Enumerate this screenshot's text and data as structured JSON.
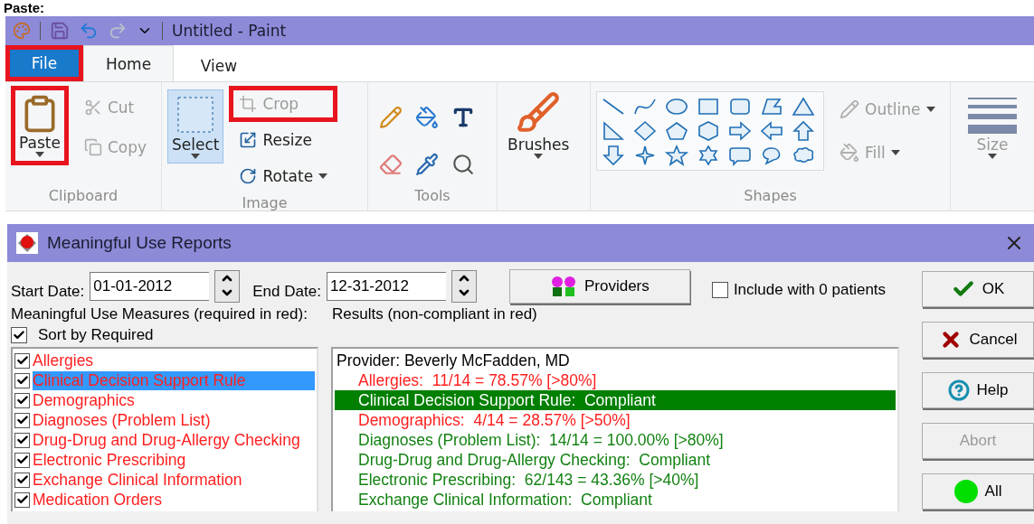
{
  "caption": "Paste:",
  "paint": {
    "title": "Untitled - Paint",
    "tabs": [
      {
        "label": "File",
        "kind": "file",
        "highlighted": true
      },
      {
        "label": "Home",
        "selected": true,
        "kind": "tab",
        "highlighted": false
      },
      {
        "label": "View",
        "selected": false,
        "kind": "tab",
        "highlighted": false
      }
    ],
    "clipboard": {
      "label": "Clipboard",
      "paste": {
        "label": "Paste",
        "highlighted": true
      },
      "cut": {
        "label": "Cut",
        "disabled": true
      },
      "copy": {
        "label": "Copy",
        "disabled": true
      }
    },
    "image": {
      "label": "Image",
      "select": {
        "label": "Select",
        "selected": true
      },
      "crop": {
        "label": "Crop",
        "disabled": true,
        "highlighted": true
      },
      "resize": {
        "label": "Resize",
        "disabled": false
      },
      "rotate": {
        "label": "Rotate",
        "disabled": false
      }
    },
    "tools": {
      "label": "Tools"
    },
    "brushes": {
      "label": "Brushes"
    },
    "shapes": {
      "label": "Shapes",
      "outline": {
        "label": "Outline",
        "disabled": true
      },
      "fill": {
        "label": "Fill",
        "disabled": true
      }
    },
    "size": {
      "label": "Size",
      "disabled": true
    }
  },
  "dialog": {
    "title": "Meaningful Use Reports",
    "start_date": {
      "label": "Start Date:",
      "value": "01-01-2012"
    },
    "end_date": {
      "label": "End Date:",
      "value": "12-31-2012"
    },
    "providers_button": "Providers",
    "include_zero": {
      "label": "Include with 0 patients",
      "checked": false
    },
    "measures_label": "Meaningful Use Measures (required in red):",
    "results_label": "Results (non-compliant in red)",
    "sort_by_required": {
      "label": "Sort by Required",
      "checked": true
    },
    "measures": [
      {
        "label": "Allergies",
        "checked": true,
        "required": true,
        "selected": false
      },
      {
        "label": "Clinical Decision Support Rule",
        "checked": true,
        "required": true,
        "selected": true
      },
      {
        "label": "Demographics",
        "checked": true,
        "required": true,
        "selected": false
      },
      {
        "label": "Diagnoses (Problem List)",
        "checked": true,
        "required": true,
        "selected": false
      },
      {
        "label": "Drug-Drug and Drug-Allergy Checking",
        "checked": true,
        "required": true,
        "selected": false
      },
      {
        "label": "Electronic Prescribing",
        "checked": true,
        "required": true,
        "selected": false
      },
      {
        "label": "Exchange Clinical Information",
        "checked": true,
        "required": true,
        "selected": false
      },
      {
        "label": "Medication Orders",
        "checked": true,
        "required": true,
        "selected": false
      }
    ],
    "results": [
      {
        "text": "Provider: Beverly McFadden, MD",
        "kind": "provider",
        "selected": false
      },
      {
        "text": "Allergies:  11/14 = 78.57% [>80%]",
        "kind": "measure",
        "compliant": false,
        "selected": false
      },
      {
        "text": "Clinical Decision Support Rule:  Compliant",
        "kind": "measure",
        "compliant": true,
        "selected": true
      },
      {
        "text": "Demographics:  4/14 = 28.57% [>50%]",
        "kind": "measure",
        "compliant": false,
        "selected": false
      },
      {
        "text": "Diagnoses (Problem List):  14/14 = 100.00% [>80%]",
        "kind": "measure",
        "compliant": true,
        "selected": false
      },
      {
        "text": "Drug-Drug and Drug-Allergy Checking:  Compliant",
        "kind": "measure",
        "compliant": true,
        "selected": false
      },
      {
        "text": "Electronic Prescribing:  62/143 = 43.36% [>40%]",
        "kind": "measure",
        "compliant": true,
        "selected": false
      },
      {
        "text": "Exchange Clinical Information:  Compliant",
        "kind": "measure",
        "compliant": true,
        "selected": false
      }
    ],
    "buttons": [
      {
        "label": "OK",
        "kind": "ok",
        "disabled": false
      },
      {
        "label": "Cancel",
        "kind": "cancel",
        "disabled": false
      },
      {
        "label": "Help",
        "kind": "help",
        "disabled": false
      },
      {
        "label": "Abort",
        "kind": "abort",
        "disabled": true
      },
      {
        "label": "All",
        "kind": "all",
        "disabled": false
      }
    ]
  }
}
